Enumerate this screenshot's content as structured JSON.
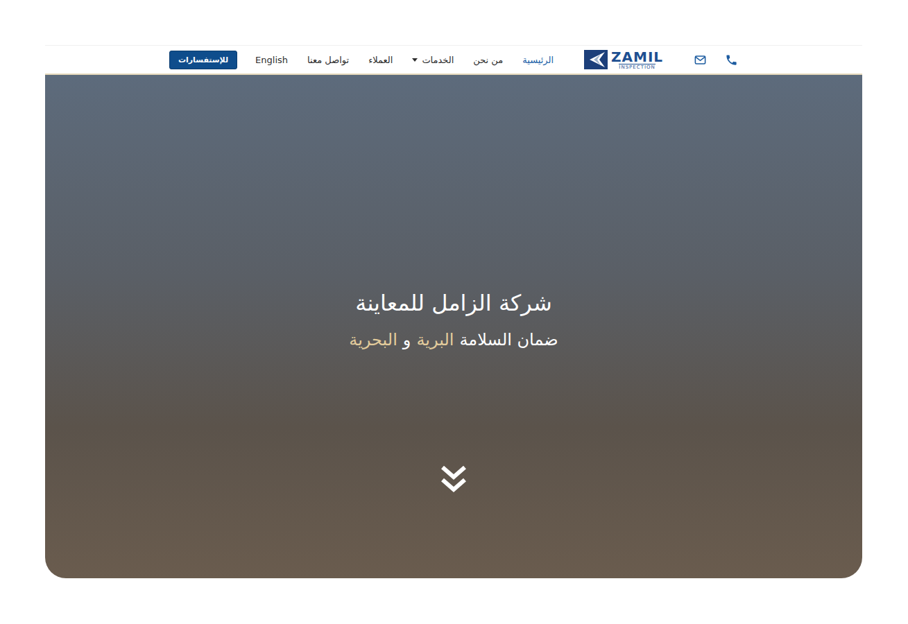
{
  "header": {
    "logo": {
      "name": "ZAMIL",
      "tagline": "INSPECTION"
    },
    "nav": [
      {
        "label": "الرئيسية",
        "selected": true,
        "dropdown": false
      },
      {
        "label": "من نحن",
        "selected": false,
        "dropdown": false
      },
      {
        "label": "الخدمات",
        "selected": false,
        "dropdown": true
      },
      {
        "label": "العملاء",
        "selected": false,
        "dropdown": false
      },
      {
        "label": "تواصل معنا",
        "selected": false,
        "dropdown": false
      },
      {
        "label": "English",
        "selected": false,
        "dropdown": false
      }
    ],
    "cta": "للإستفسارات"
  },
  "hero": {
    "title": "شركة الزامل للمعاينة",
    "subtitle": [
      {
        "text": "ضمان السلامة",
        "highlight": false
      },
      {
        "text": "البرية",
        "highlight": true
      },
      {
        "text": "و",
        "highlight": false
      },
      {
        "text": "البحرية",
        "highlight": true
      }
    ]
  }
}
